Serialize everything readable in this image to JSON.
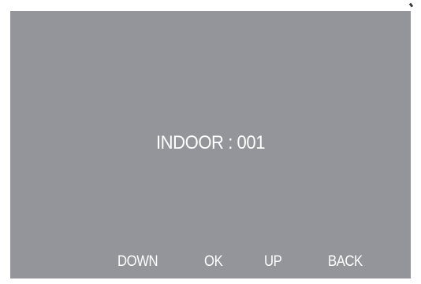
{
  "screen": {
    "label": "INDOOR : 001",
    "background_color": "#94959a",
    "text_color": "#ffffff"
  },
  "softkeys": {
    "down": "DOWN",
    "ok": "OK",
    "up": "UP",
    "back": "BACK"
  }
}
